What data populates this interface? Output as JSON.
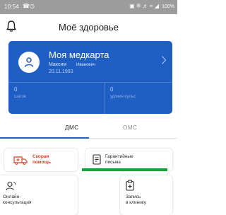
{
  "status_bar": {
    "time": "10:54",
    "left_icons": [
      "phone-icon",
      "alarm-icon"
    ],
    "right_icons": [
      "sim-icon",
      "bluetooth-icon",
      "sound-icon",
      "alarm-icon",
      "wifi-icon",
      "signal-icon"
    ],
    "battery": "100%"
  },
  "header": {
    "title": "Моё здоровье",
    "bell_icon": "bell-icon"
  },
  "medcard": {
    "title": "Моя медкарта",
    "first_name": "Максим",
    "last_name": "Иванович",
    "birth_date": "20.11.1993",
    "chevron_icon": "chevron-right-icon",
    "avatar_icon": "person-icon",
    "background": "#1f5fc4",
    "stats": [
      {
        "value": "0",
        "label": "шагов"
      },
      {
        "value": "0",
        "label": "уд/мин пульс"
      }
    ]
  },
  "tabs": [
    {
      "label": "ДМС",
      "active": true
    },
    {
      "label": "ОМС",
      "active": false
    }
  ],
  "tiles": [
    {
      "line1": "Скорая",
      "line2": "помощь",
      "icon": "ambulance-icon",
      "color": "#d9422a"
    },
    {
      "line1": "Гарантийные",
      "line2": "письма",
      "icon": "document-icon",
      "color": "#2b2b2b"
    },
    {
      "line1": "Онлайн-",
      "line2": "консультация",
      "icon": "doctor-icon",
      "color": "#2b2b2b"
    },
    {
      "line1": "Запись",
      "line2": "в клинику",
      "icon": "appointment-icon",
      "color": "#2b2b2b"
    }
  ],
  "accent_colors": {
    "primary": "#1f5fc4",
    "danger": "#d9422a",
    "success": "#15a43c"
  }
}
